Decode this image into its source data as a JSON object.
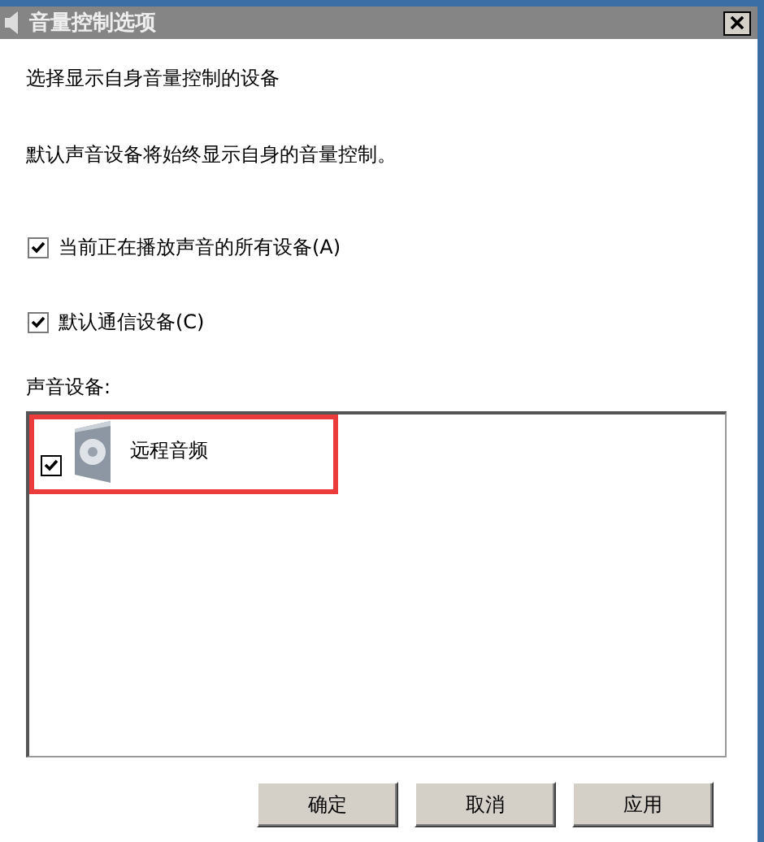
{
  "window": {
    "title": "音量控制选项"
  },
  "description": [
    "选择显示自身音量控制的设备",
    "默认声音设备将始终显示自身的音量控制。"
  ],
  "options": [
    {
      "label": "当前正在播放声音的所有设备(A)",
      "checked": true
    },
    {
      "label": "默认通信设备(C)",
      "checked": true
    }
  ],
  "device_list": {
    "label": "声音设备:",
    "items": [
      {
        "name": "远程音频",
        "checked": true,
        "highlighted": true
      }
    ]
  },
  "buttons": [
    {
      "label": "确定",
      "disabled": false
    },
    {
      "label": "取消",
      "disabled": false
    },
    {
      "label": "应用",
      "disabled": false
    }
  ]
}
